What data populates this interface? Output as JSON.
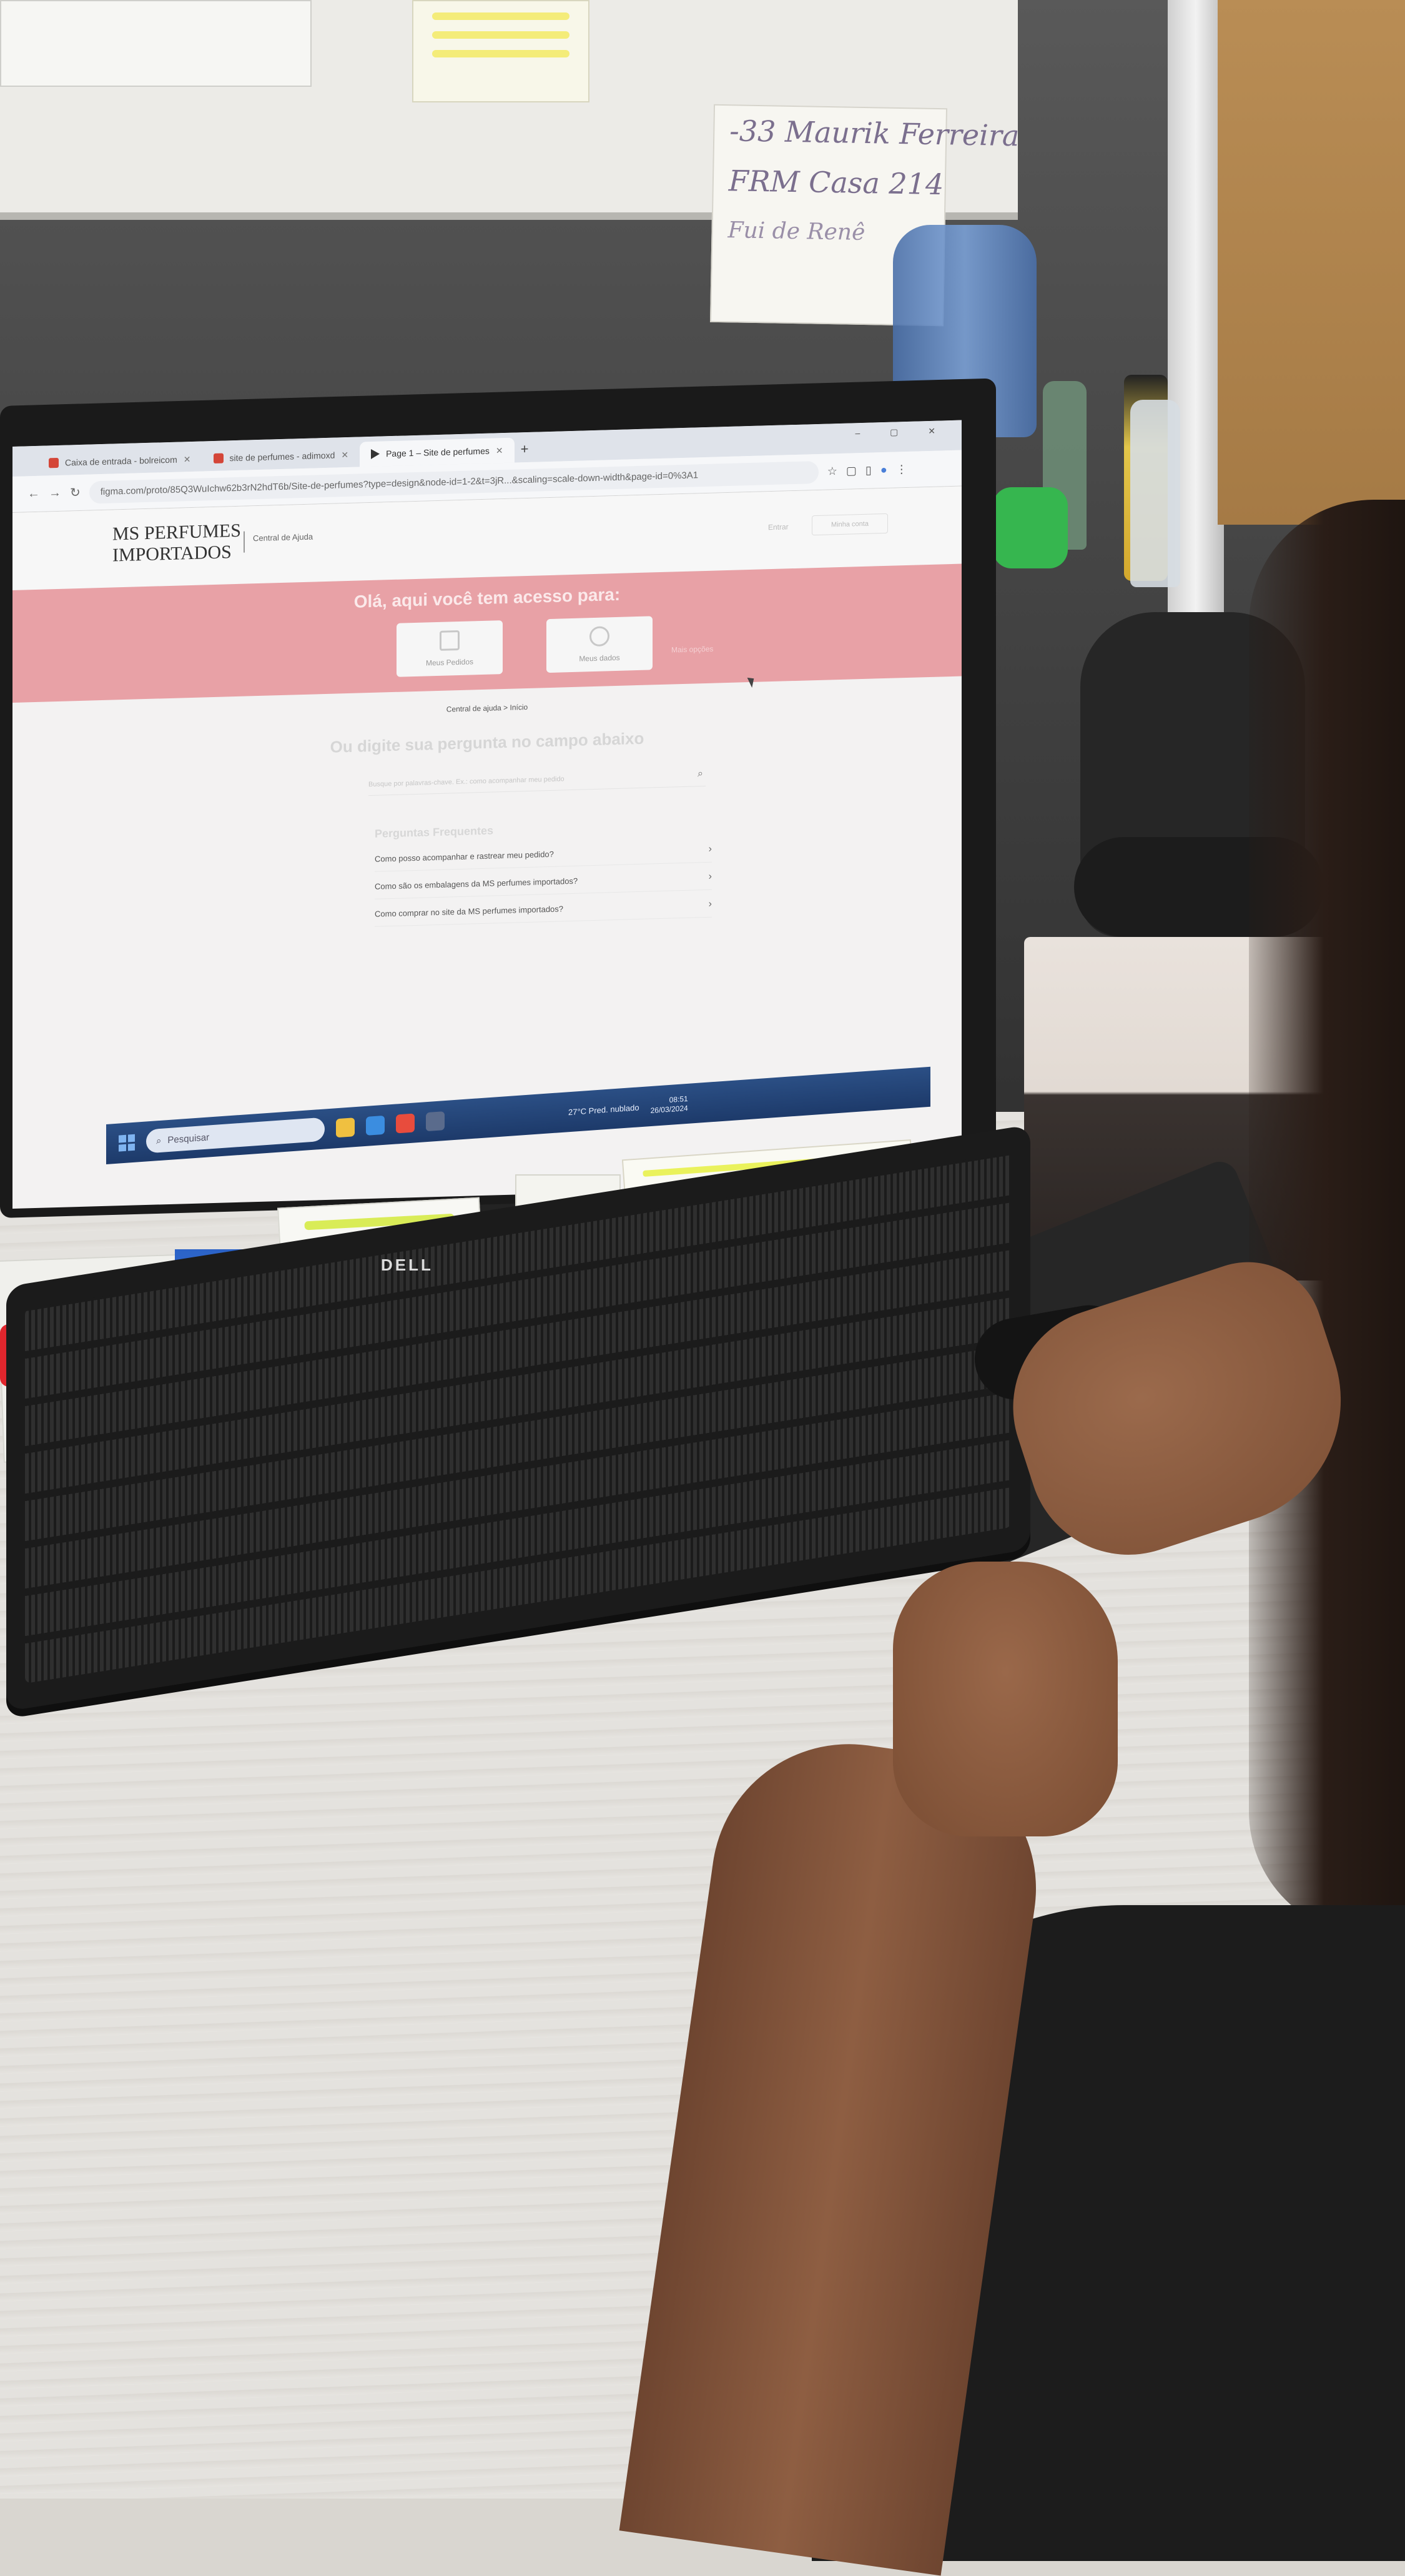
{
  "photo": {
    "wall_note": [
      "-33 Maurik Ferreira",
      "FRM Casa 214",
      "Fui de Renê"
    ]
  },
  "browser": {
    "tabs": [
      {
        "label": "Caixa de entrada - bolreicom",
        "icon": "gmail-icon",
        "active": false
      },
      {
        "label": "site de perfumes - adimoxd",
        "icon": "gmail-icon",
        "active": false
      },
      {
        "label": "Page 1 – Site de perfumes",
        "icon": "figma-play-icon",
        "active": true
      }
    ],
    "new_tab_label": "+",
    "window_controls": "– ▢ ✕",
    "url": "figma.com/proto/85Q3WuIchw62b3rN2hdT6b/Site-de-perfumes?type=design&node-id=1-2&t=3jR...&scaling=scale-down-width&page-id=0%3A1"
  },
  "site": {
    "logo_line1": "MS PERFUMES",
    "logo_line2": "IMPORTADOS",
    "header_link": "Central de Ajuda",
    "header_right1": "Entrar",
    "header_right2": "Minha conta",
    "banner_title": "Olá, aqui você tem acesso para:",
    "card_orders_label": "Meus Pedidos",
    "card_data_label": "Meus dados",
    "banner_faint": "Mais opções",
    "breadcrumb": "Central de ajuda  >  Início",
    "ask_title": "Ou digite sua pergunta no campo abaixo",
    "search_placeholder": "Busque por palavras-chave. Ex.: como acompanhar meu pedido",
    "faq_title": "Perguntas Frequentes",
    "faq": [
      "Como posso acompanhar e rastrear meu pedido?",
      "Como são os embalagens da MS perfumes importados?",
      "Como comprar no site da MS perfumes importados?"
    ],
    "chevron": "›",
    "search_icon_glyph": "⌕"
  },
  "taskbar": {
    "search_label": "Pesquisar",
    "weather": "27°C  Pred. nublado",
    "time": "08:51",
    "date": "26/03/2024"
  },
  "hardware": {
    "keyboard_brand": "DELL"
  },
  "colors": {
    "banner": "#e8a1a6",
    "taskbar": "#1d3a6a",
    "desk": "#e4e2de"
  }
}
